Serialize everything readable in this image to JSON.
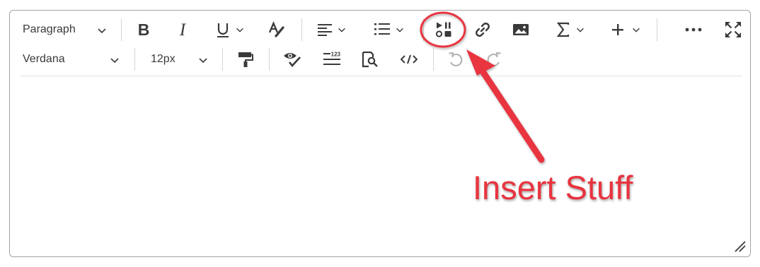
{
  "toolbar": {
    "block_format": "Paragraph",
    "font_family": "Verdana",
    "font_size": "12px",
    "items": {
      "bold": "bold-icon",
      "italic": "italic-icon",
      "underline": "underline-icon",
      "text_color": "text-color-icon",
      "align": "align-left-icon",
      "list": "bullet-list-icon",
      "insert_stuff": "insert-stuff-icon",
      "link": "link-icon",
      "image": "image-icon",
      "equation": "sigma-icon",
      "insert_more": "plus-icon",
      "more_actions": "ellipsis-icon",
      "fullscreen": "fullscreen-icon",
      "format_painter": "format-painter-icon",
      "accessibility_checker": "accessibility-check-icon",
      "word_count": "word-count-icon",
      "find_replace": "find-replace-icon",
      "source_code": "source-code-icon",
      "undo": "undo-icon",
      "redo": "redo-icon"
    }
  },
  "annotation": {
    "text": "Insert Stuff",
    "color": "#e8343f"
  },
  "colors": {
    "icon": "#3a3a3a",
    "disabled_icon": "#b5b5b5",
    "border": "#a3a3a3",
    "annotation_red": "#e8343f"
  }
}
